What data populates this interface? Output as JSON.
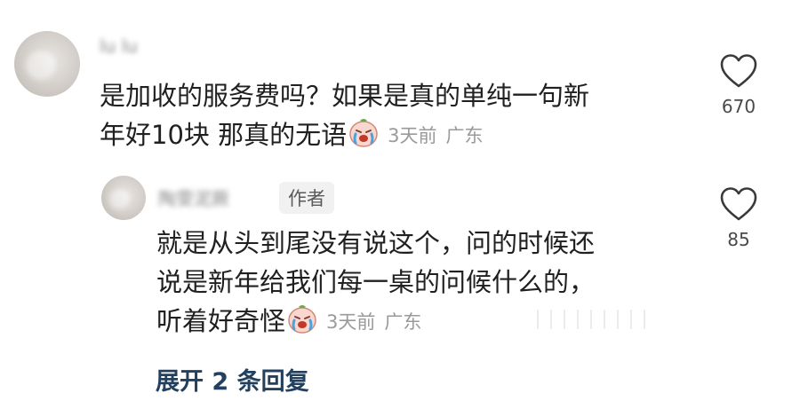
{
  "comment": {
    "username": "lu lu",
    "text_line1": "是加收的服务费吗？如果是真的单纯一句新",
    "text_line2": "年好10块 那真的无语",
    "time": "3天前",
    "location": "广东",
    "likes": "670",
    "emoji": "crying-face-emoji"
  },
  "reply": {
    "username": "陶雯泥厥",
    "badge": "作者",
    "text_line1": "就是从头到尾没有说这个，问的时候还",
    "text_line2": "说是新年给我们每一桌的问候什么的，",
    "text_line3": "听着好奇怪",
    "time": "3天前",
    "location": "广东",
    "likes": "85",
    "emoji": "crying-face-emoji"
  },
  "expand_label": "展开 2 条回复",
  "colors": {
    "expand": "#23405f",
    "meta": "#9a9a9a"
  }
}
